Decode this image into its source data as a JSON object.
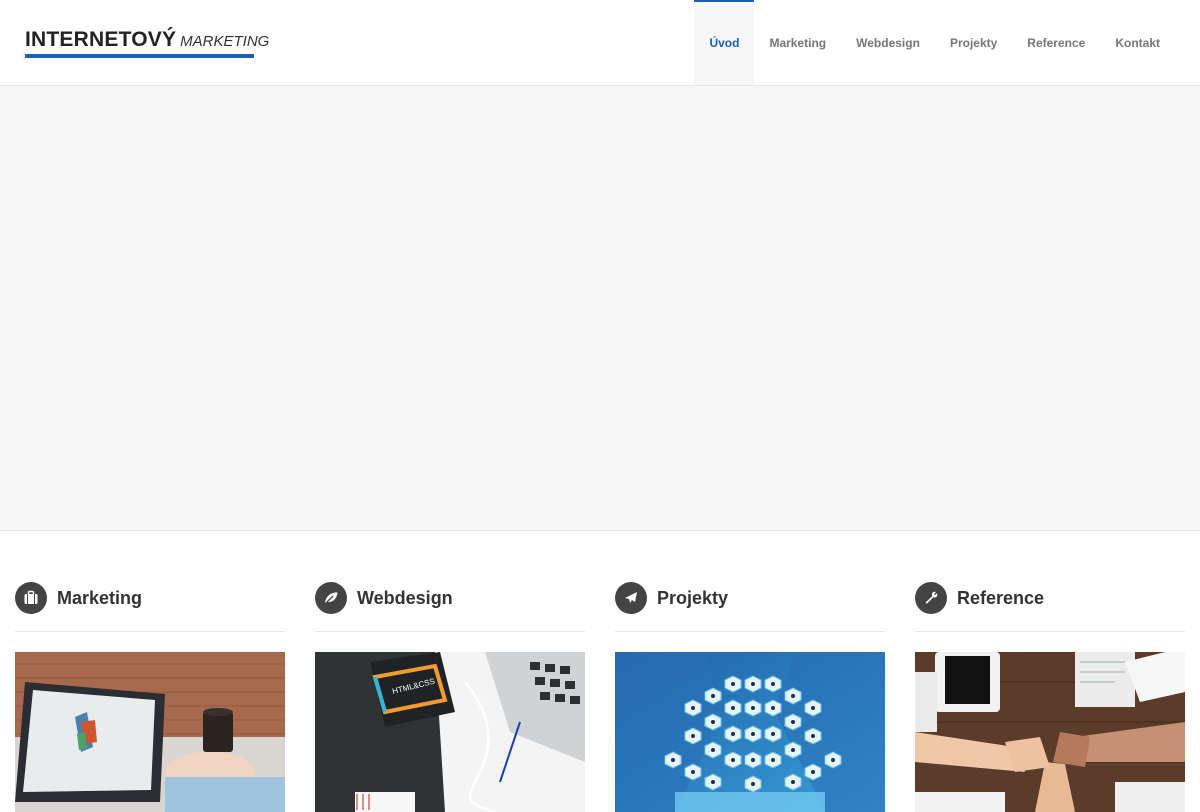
{
  "logo": {
    "strong": "INTERNETOVÝ",
    "light": "MARKETING"
  },
  "nav": [
    {
      "label": "Úvod",
      "active": true
    },
    {
      "label": "Marketing",
      "active": false
    },
    {
      "label": "Webdesign",
      "active": false
    },
    {
      "label": "Projekty",
      "active": false
    },
    {
      "label": "Reference",
      "active": false
    },
    {
      "label": "Kontakt",
      "active": false
    }
  ],
  "columns": [
    {
      "title": "Marketing",
      "icon": "briefcase-icon"
    },
    {
      "title": "Webdesign",
      "icon": "leaf-icon"
    },
    {
      "title": "Projekty",
      "icon": "airplane-icon"
    },
    {
      "title": "Reference",
      "icon": "wrench-icon"
    }
  ],
  "colors": {
    "accent": "#1b5fb8",
    "icon_bg": "#444444",
    "text": "#333333"
  }
}
